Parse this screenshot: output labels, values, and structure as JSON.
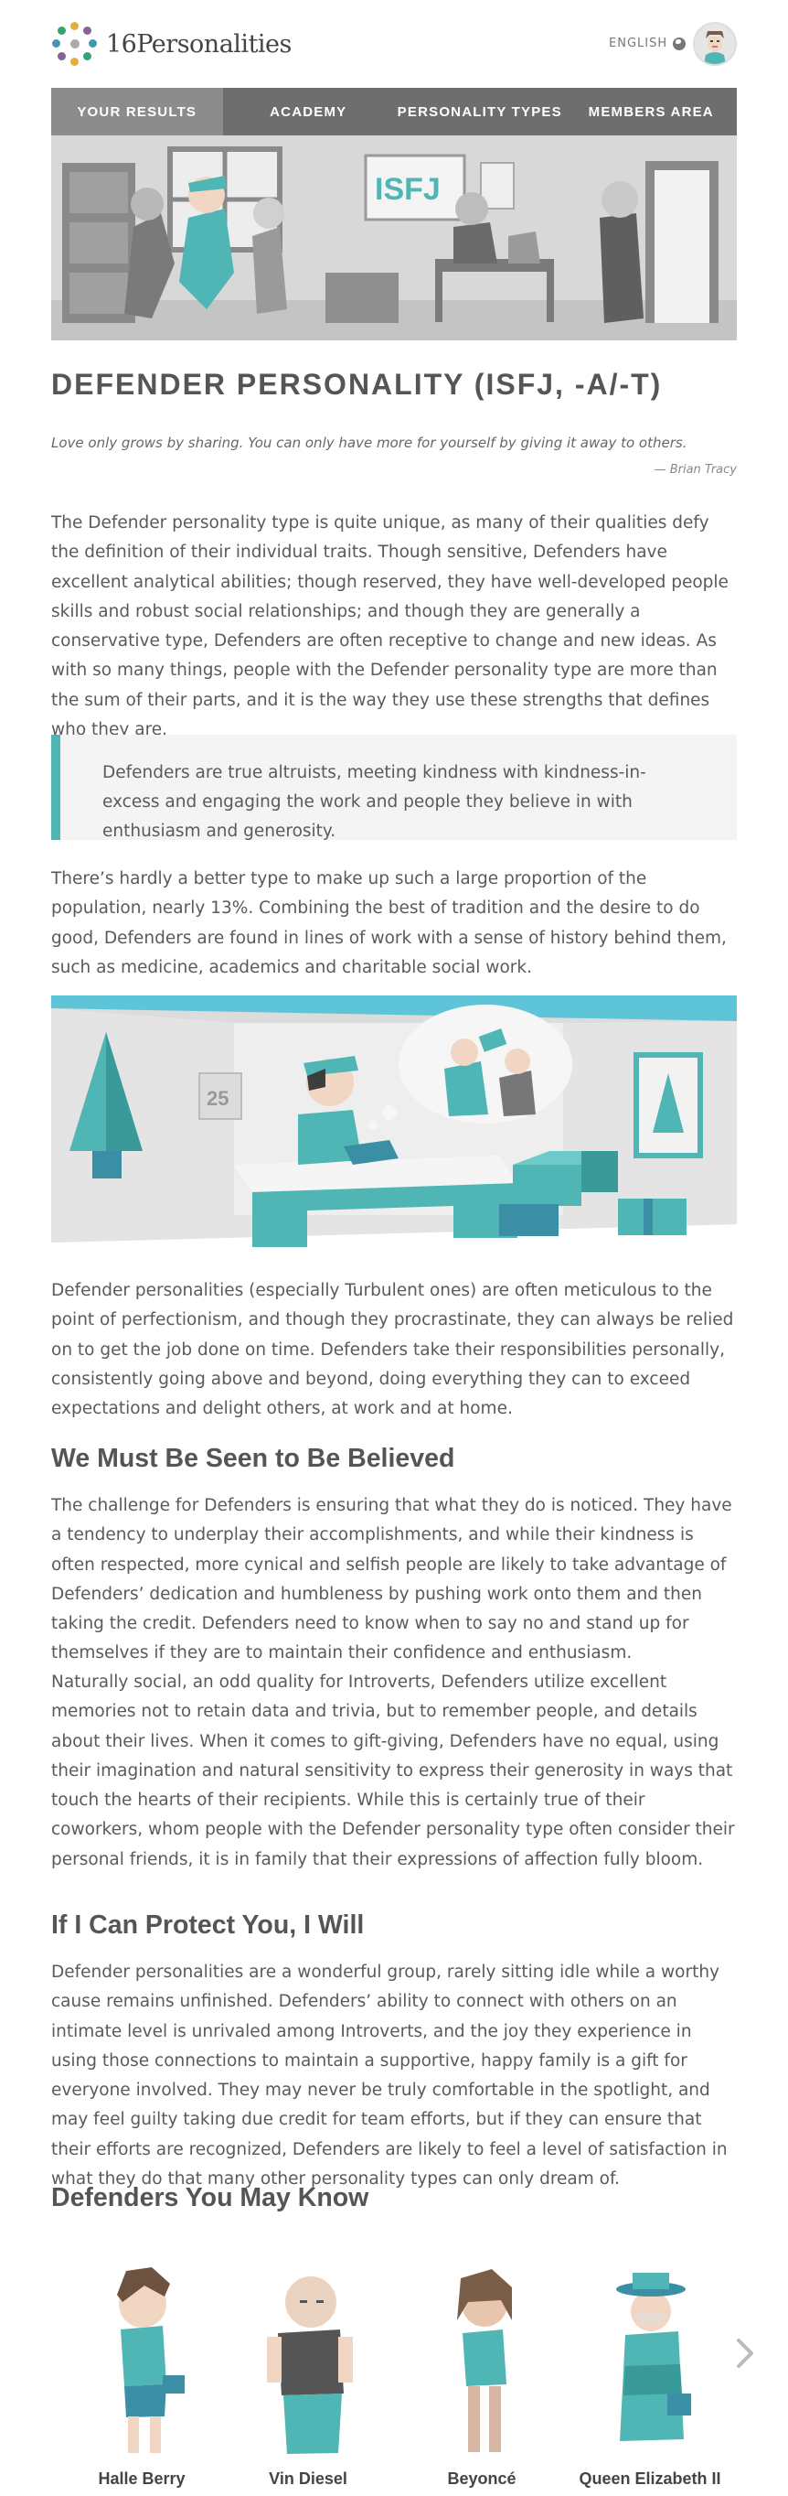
{
  "header": {
    "logo_text": "16Personalities",
    "language": "ENGLISH",
    "globe_icon": "globe-icon",
    "avatar_icon": "user-avatar-icon"
  },
  "nav": {
    "items": [
      {
        "label": "YOUR RESULTS",
        "active": true
      },
      {
        "label": "ACADEMY",
        "active": false
      },
      {
        "label": "PERSONALITY TYPES",
        "active": false
      },
      {
        "label": "MEMBERS AREA",
        "active": false
      }
    ]
  },
  "hero": {
    "sign_text": "ISFJ"
  },
  "article": {
    "title": "DEFENDER PERSONALITY (ISFJ, -A/-T)",
    "quote": "Love only grows by sharing. You can only have more for yourself by giving it away to others.",
    "quote_author": "— Brian Tracy",
    "intro": "The Defender personality type is quite unique, as many of their qualities defy the definition of their individual traits. Though sensitive, Defenders have excellent analytical abilities; though reserved, they have well-developed people skills and robust social relationships; and though they are generally a conservative type, Defenders are often receptive to change and new ideas. As with so many things, people with the Defender personality type are more than the sum of their parts, and it is the way they use these strengths that defines who they are.",
    "callout": "Defenders are true altruists, meeting kindness with kindness-in-excess and engaging the work and people they believe in with enthusiasm and generosity.",
    "para2": "There’s hardly a better type to make up such a large proportion of the population, nearly 13%. Combining the best of tradition and the desire to do good, Defenders are found in lines of work with a sense of history behind them, such as medicine, academics and charitable social work.",
    "calendar_text": "25",
    "para3": "Defender personalities (especially Turbulent ones) are often meticulous to the point of perfectionism, and though they procrastinate, they can always be relied on to get the job done on time. Defenders take their responsibilities personally, consistently going above and beyond, doing everything they can to exceed expectations and delight others, at work and at home.",
    "h2_seen": "We Must Be Seen to Be Believed",
    "para4": "The challenge for Defenders is ensuring that what they do is noticed. They have a tendency to underplay their accomplishments, and while their kindness is often respected, more cynical and selfish people are likely to take advantage of Defenders’ dedication and humbleness by pushing work onto them and then taking the credit. Defenders need to know when to say no and stand up for themselves if they are to maintain their confidence and enthusiasm.",
    "para5": "Naturally social, an odd quality for Introverts, Defenders utilize excellent memories not to retain data and trivia, but to remember people, and details about their lives. When it comes to gift-giving, Defenders have no equal, using their imagination and natural sensitivity to express their generosity in ways that touch the hearts of their recipients. While this is certainly true of their coworkers, whom people with the Defender personality type often consider their personal friends, it is in family that their expressions of affection fully bloom.",
    "h2_protect": "If I Can Protect You, I Will",
    "para6": "Defender personalities are a wonderful group, rarely sitting idle while a worthy cause remains unfinished. Defenders’ ability to connect with others on an intimate level is unrivaled among Introverts, and the joy they experience in using those connections to maintain a supportive, happy family is a gift for everyone involved. They may never be truly comfortable in the spotlight, and may feel guilty taking due credit for team efforts, but if they can ensure that their efforts are recognized, Defenders are likely to feel a level of satisfaction in what they do that many other personality types can only dream of.",
    "h2_know": "Defenders You May Know"
  },
  "famous": [
    {
      "name": "Halle Berry"
    },
    {
      "name": "Vin Diesel"
    },
    {
      "name": "Beyoncé"
    },
    {
      "name": "Queen Elizabeth II"
    }
  ],
  "colors": {
    "teal": "#4fb5b5",
    "nav_bg": "#6e6e6e",
    "nav_active": "#8c8c8c",
    "callout_bg": "#f4f4f4"
  }
}
